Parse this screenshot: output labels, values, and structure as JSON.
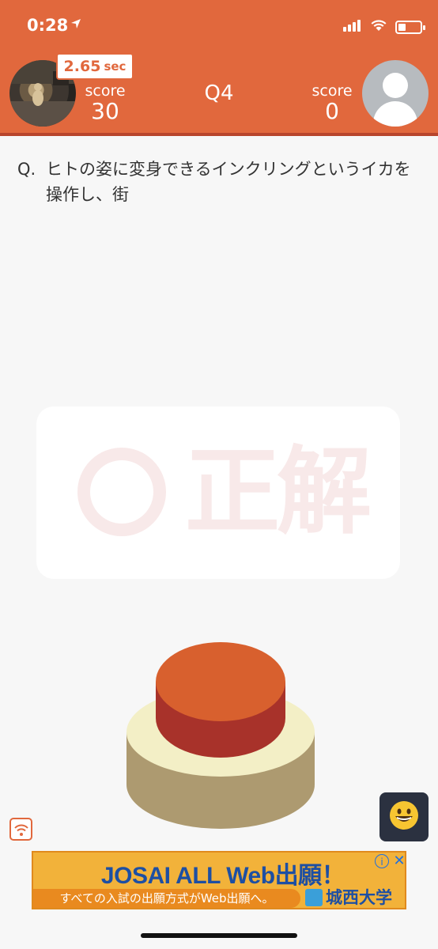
{
  "status_bar": {
    "time": "0:28",
    "location_arrow": "location-arrow-icon"
  },
  "header": {
    "player": {
      "timer_value": "2.65",
      "timer_unit": "sec",
      "score_label": "score",
      "score_value": "30"
    },
    "question_number": "Q4",
    "opponent": {
      "score_label": "score",
      "score_value": "0"
    }
  },
  "question": {
    "prefix": "Q.",
    "text": "ヒトの姿に変身できるインクリングというイカを操作し、街"
  },
  "result": {
    "symbol": "〇",
    "label": "正解"
  },
  "buzzer": {
    "icon": "buzzer-button"
  },
  "controls": {
    "connection_icon": "wifi-icon",
    "emoji": "😀"
  },
  "ad": {
    "headline": "JOSAI ALL Web出願！",
    "subtext": "すべての入試の出願方式がWeb出願へ。",
    "logo": "城西大学",
    "info": "i",
    "close": "✕"
  },
  "colors": {
    "accent": "#e1683d",
    "buzzer_top": "#d8602e",
    "buzzer_side": "#a8322a",
    "base_top": "#f3efc6",
    "base_side": "#ad9a70"
  }
}
